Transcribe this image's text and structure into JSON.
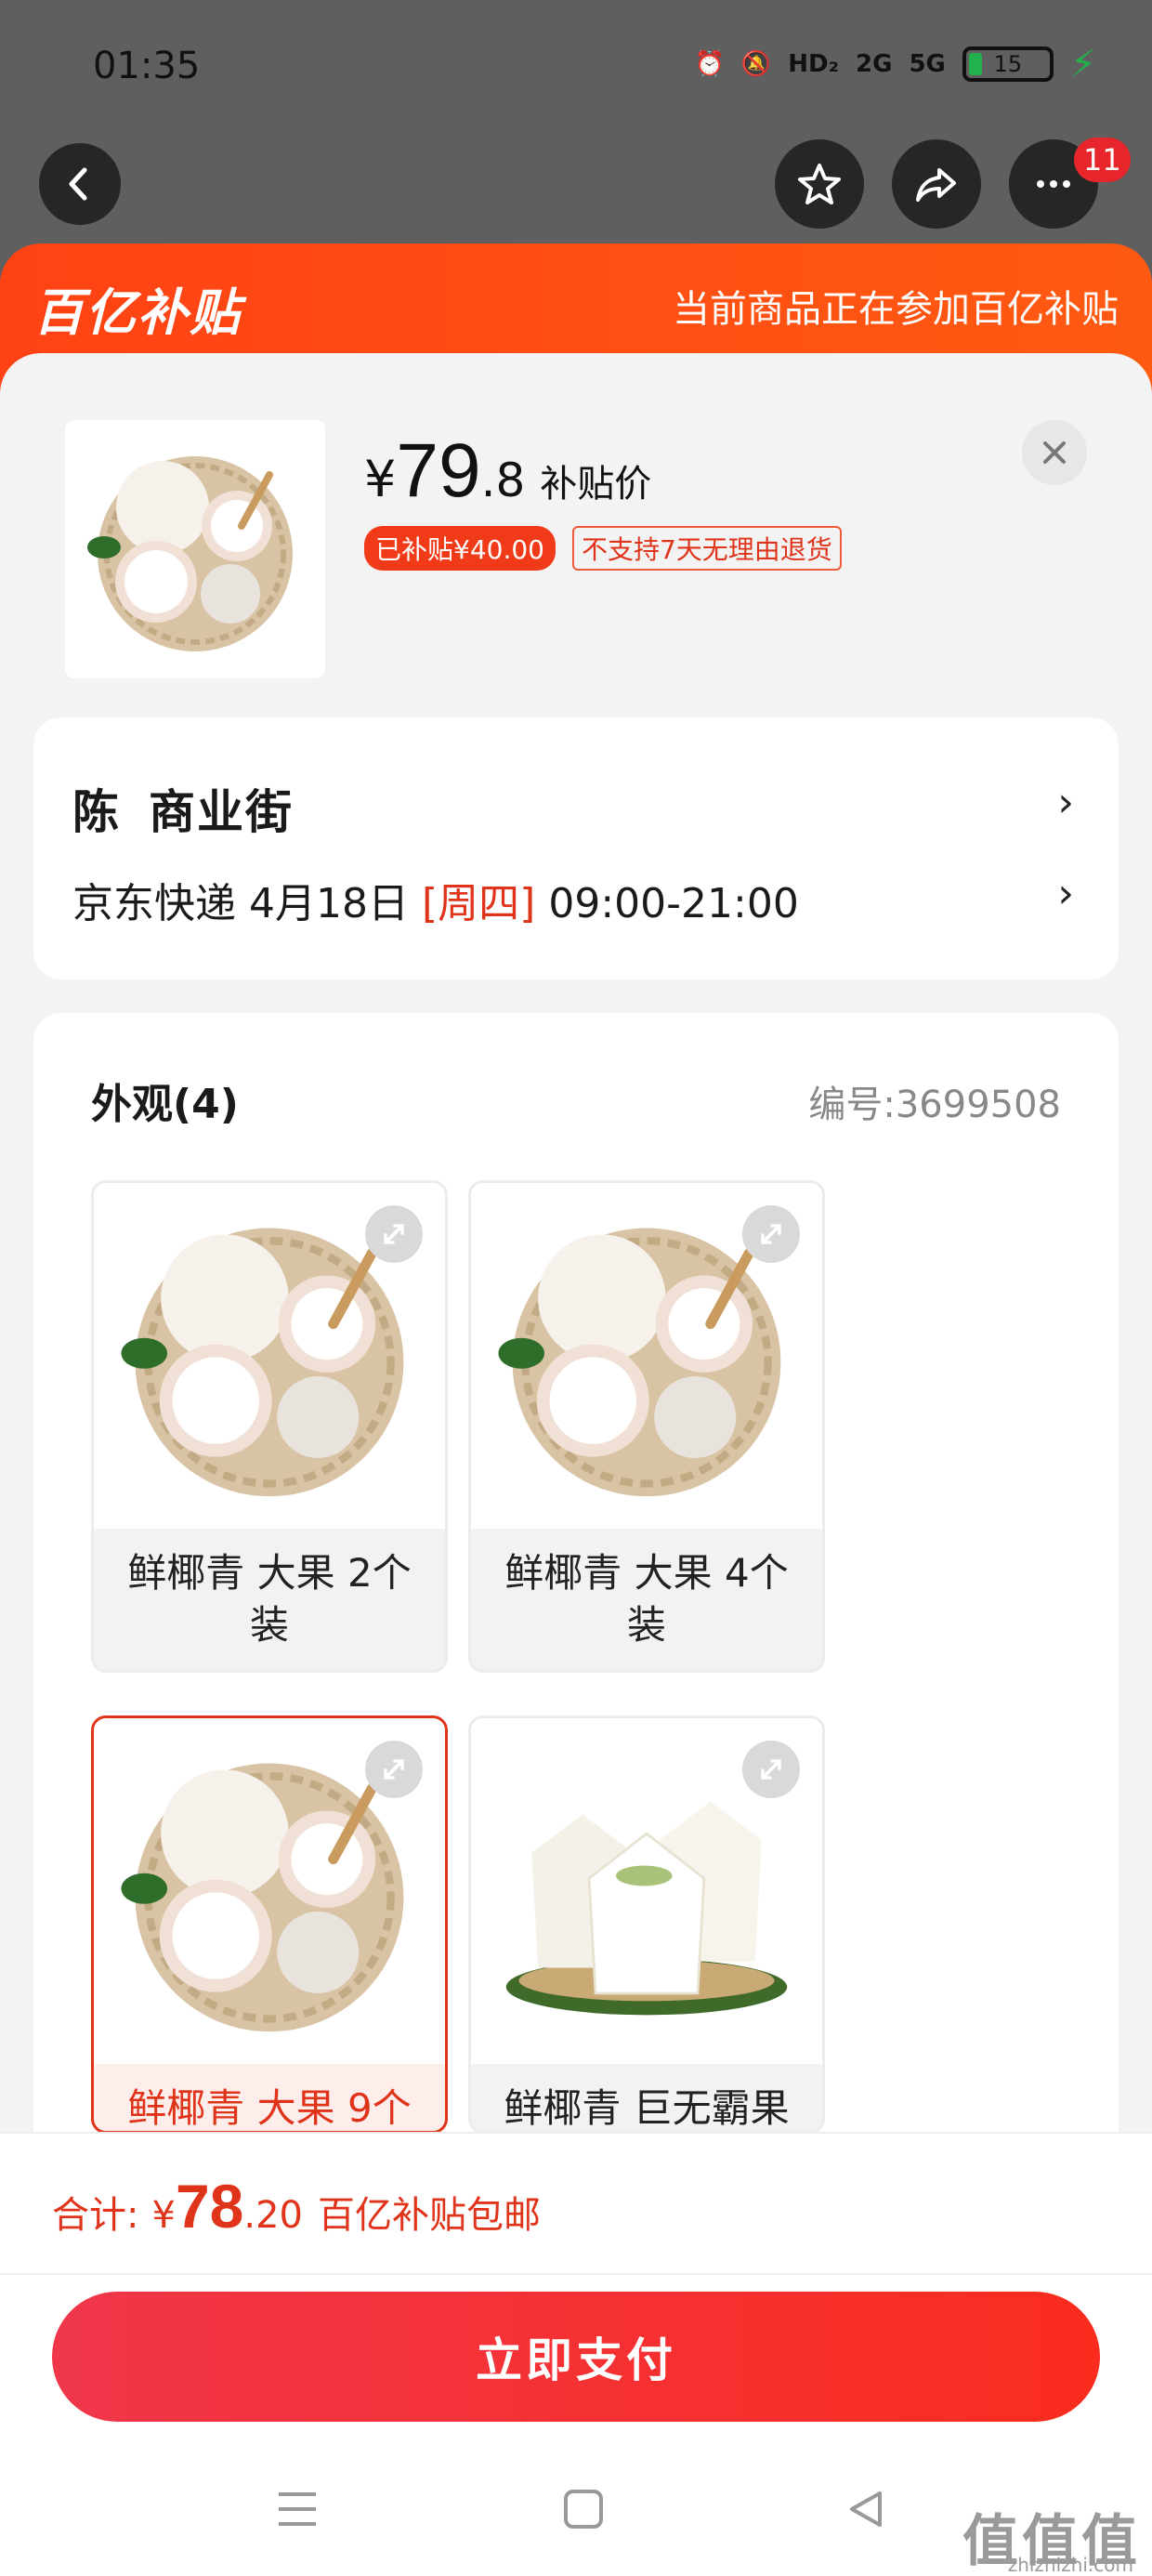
{
  "status_bar": {
    "time": "01:35",
    "network_hd": "HD₂",
    "network_2g": "2G",
    "network_5g": "5G",
    "battery": "15"
  },
  "nav": {
    "notification_count": "11"
  },
  "banner": {
    "logo": "百亿补贴",
    "text": "当前商品正在参加百亿补贴"
  },
  "product": {
    "price_symbol": "¥",
    "price_int": "79",
    "price_dec": ".8",
    "price_label": "补贴价",
    "subsidy_tag": "已补贴¥40.00",
    "return_tag": "不支持7天无理由退货"
  },
  "address": {
    "name": "陈",
    "street": "商业街",
    "courier": "京东快递",
    "date": "4月18日",
    "weekday": "[周四]",
    "time_window": "09:00-21:00"
  },
  "options": {
    "title": "外观(4)",
    "product_id": "编号:3699508",
    "items": [
      {
        "label": "鲜椰青 大果 2个装",
        "selected": false
      },
      {
        "label": "鲜椰青 大果 4个装",
        "selected": false
      },
      {
        "label": "鲜椰青 大果 9个",
        "selected": true
      },
      {
        "label": "鲜椰青 巨无霸果",
        "selected": false
      }
    ]
  },
  "footer": {
    "total_label": "合计:",
    "total_symbol": "¥",
    "total_int": "78",
    "total_dec": ".20",
    "shipping": "百亿补贴包邮",
    "pay_button": "立即支付"
  },
  "watermark": {
    "logo": "值值值",
    "url": "zhizhizhi.com"
  },
  "colors": {
    "brand_red": "#e0341a",
    "banner_orange": "#ff4214",
    "pay_gradient_start": "#f0364a",
    "pay_gradient_end": "#fa2c1e"
  }
}
